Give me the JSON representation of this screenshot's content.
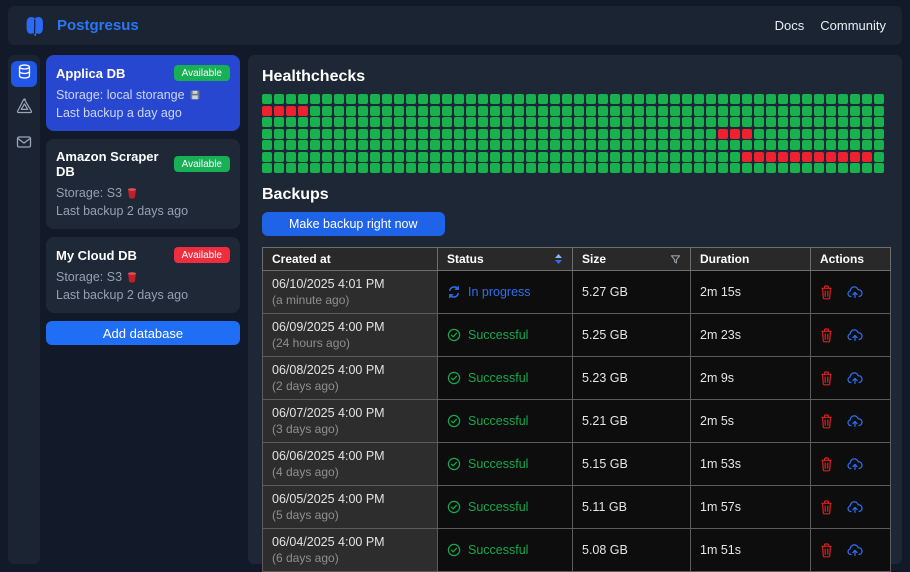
{
  "topbar": {
    "brand": "Postgresus",
    "nav": [
      {
        "label": "Docs"
      },
      {
        "label": "Community"
      }
    ]
  },
  "sidebar": {
    "rail_icons": [
      {
        "name": "databases",
        "active": true
      },
      {
        "name": "storage",
        "active": false
      },
      {
        "name": "notifications",
        "active": false
      }
    ],
    "databases": [
      {
        "name": "Applica DB",
        "badge": "Available",
        "badge_color": "green",
        "storage": "Storage: local storange",
        "storage_icon": "disk",
        "last_backup": "Last backup a day ago",
        "selected": true
      },
      {
        "name": "Amazon Scraper DB",
        "badge": "Available",
        "badge_color": "green",
        "storage": "Storage: S3",
        "storage_icon": "s3",
        "last_backup": "Last backup 2 days ago",
        "selected": false
      },
      {
        "name": "My Cloud DB",
        "badge": "Available",
        "badge_color": "red",
        "storage": "Storage: S3",
        "storage_icon": "s3",
        "last_backup": "Last backup 2 days ago",
        "selected": false
      }
    ],
    "add_button": "Add database"
  },
  "main": {
    "healthchecks": {
      "title": "Healthchecks",
      "grid": {
        "rows": 7,
        "cols": 52,
        "green_color": "#17b14e",
        "red_color": "#ee2130",
        "red_cells": [
          [
            1,
            0
          ],
          [
            1,
            1
          ],
          [
            1,
            2
          ],
          [
            1,
            3
          ],
          [
            3,
            38
          ],
          [
            3,
            39
          ],
          [
            3,
            40
          ],
          [
            5,
            40
          ],
          [
            5,
            41
          ],
          [
            5,
            42
          ],
          [
            5,
            43
          ],
          [
            5,
            44
          ],
          [
            5,
            45
          ],
          [
            5,
            46
          ],
          [
            5,
            47
          ],
          [
            5,
            48
          ],
          [
            5,
            49
          ],
          [
            5,
            50
          ]
        ]
      }
    },
    "backups": {
      "title": "Backups",
      "make_backup_label": "Make backup right now",
      "table": {
        "columns": [
          {
            "label": "Created at"
          },
          {
            "label": "Status",
            "icon": "sort"
          },
          {
            "label": "Size",
            "icon": "filter"
          },
          {
            "label": "Duration"
          },
          {
            "label": "Actions"
          }
        ],
        "rows": [
          {
            "created": "06/10/2025 4:01 PM",
            "ago": "(a minute ago)",
            "status": "In progress",
            "status_type": "progress",
            "size": "5.27 GB",
            "duration": "2m 15s"
          },
          {
            "created": "06/09/2025 4:00 PM",
            "ago": "(24 hours ago)",
            "status": "Successful",
            "status_type": "success",
            "size": "5.25 GB",
            "duration": "2m 23s"
          },
          {
            "created": "06/08/2025 4:00 PM",
            "ago": "(2 days ago)",
            "status": "Successful",
            "status_type": "success",
            "size": "5.23 GB",
            "duration": "2m 9s"
          },
          {
            "created": "06/07/2025 4:00 PM",
            "ago": "(3 days ago)",
            "status": "Successful",
            "status_type": "success",
            "size": "5.21 GB",
            "duration": "2m 5s"
          },
          {
            "created": "06/06/2025 4:00 PM",
            "ago": "(4 days ago)",
            "status": "Successful",
            "status_type": "success",
            "size": "5.15 GB",
            "duration": "1m 53s"
          },
          {
            "created": "06/05/2025 4:00 PM",
            "ago": "(5 days ago)",
            "status": "Successful",
            "status_type": "success",
            "size": "5.11 GB",
            "duration": "1m 57s"
          },
          {
            "created": "06/04/2025 4:00 PM",
            "ago": "(6 days ago)",
            "status": "Successful",
            "status_type": "success",
            "size": "5.08 GB",
            "duration": "1m 51s"
          }
        ]
      }
    }
  },
  "colors": {
    "accent_blue": "#1f6ef5",
    "selected_card": "#2847d0",
    "badge_green": "#17b055",
    "badge_red": "#ef2d3e",
    "status_progress": "#2d6ff0",
    "status_success": "#16a84c",
    "action_delete": "#dd1f1f",
    "action_download": "#2d6ff0"
  }
}
